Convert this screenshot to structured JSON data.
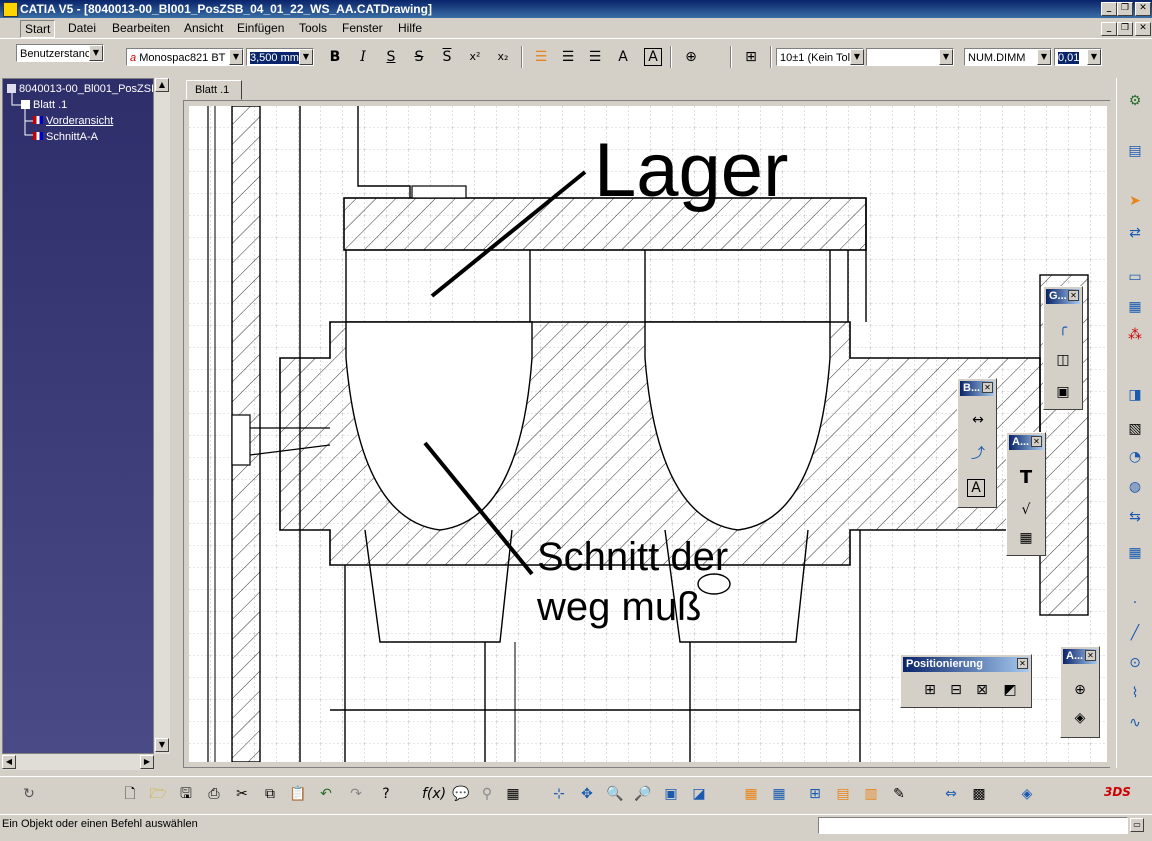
{
  "window": {
    "title": "CATIA V5 - [8040013-00_Bl001_PosZSB_04_01_22_WS_AA.CATDrawing]",
    "controls": [
      "_",
      "❐",
      "✕"
    ]
  },
  "menu": {
    "items": [
      "Start",
      "Datei",
      "Bearbeiten",
      "Ansicht",
      "Einfügen",
      "Tools",
      "Fenster",
      "Hilfe"
    ]
  },
  "text_toolbar": {
    "style": "Benutzerstanc",
    "font": "Monospac821 BT",
    "font_size": "3,500 mm",
    "bold": "B",
    "italic": "I",
    "underline": "S",
    "strike": "S",
    "overline": "S",
    "superscript": "x²",
    "subscript": "x₂",
    "tolerance": "10±1 (Kein Tol",
    "tolerance2": "",
    "numeric_display": "NUM.DIMM",
    "precision": "0,01"
  },
  "tree": {
    "root": "8040013-00_Bl001_PosZSB",
    "sheet": "Blatt .1",
    "views": [
      "Vorderansicht",
      "SchnittA-A"
    ]
  },
  "sheet_tab": "Blatt .1",
  "annotations": {
    "lager": "Lager",
    "schnitt_line1": "Schnitt der",
    "schnitt_line2": "weg muß"
  },
  "floating_toolbars": {
    "geometry": "G...",
    "dimension": "B...",
    "annotation": "A...",
    "annotation2": "A...",
    "positioning": "Positionierung"
  },
  "status": {
    "message": "Ein Objekt oder einen Befehl auswählen",
    "command_input": ""
  },
  "colors": {
    "title_bar": "#0a246a",
    "tree_bg": "#2e2e6b",
    "accent_orange": "#e8841a"
  }
}
